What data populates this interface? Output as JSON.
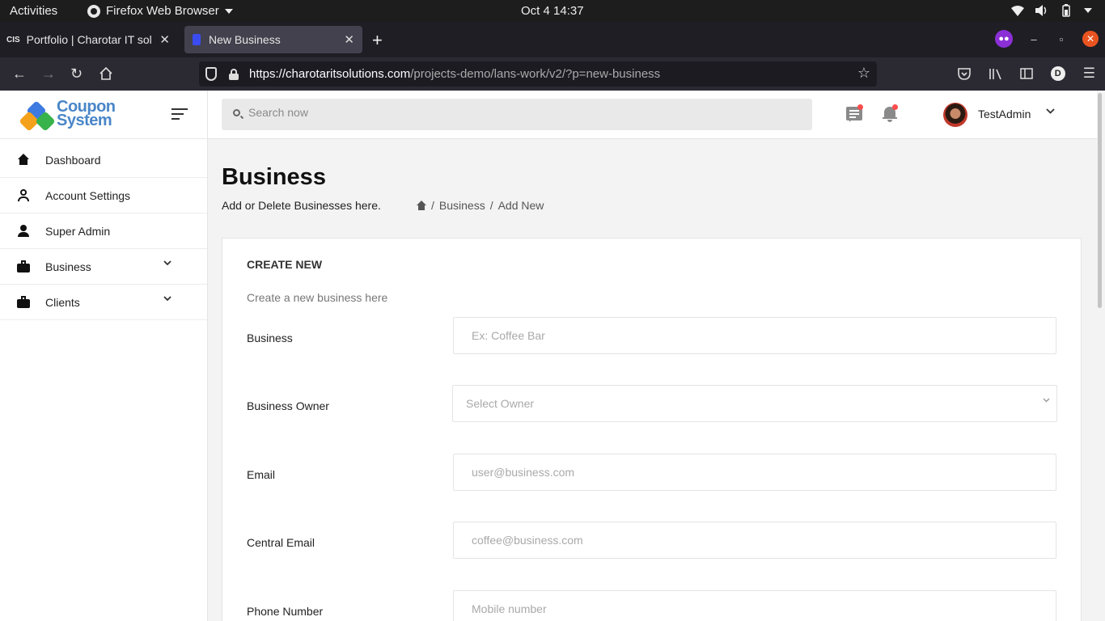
{
  "system_bar": {
    "activities": "Activities",
    "app_name": "Firefox Web Browser",
    "clock": "Oct 4  14:37"
  },
  "browser": {
    "tabs": [
      {
        "favicon": "CIS",
        "title": "Portfolio | Charotar IT sol"
      },
      {
        "favicon": "",
        "title": "New Business"
      }
    ],
    "url_host": "https://charotaritsolutions.com",
    "url_path": "/projects-demo/lans-work/v2/?p=new-business",
    "profile_initial": "D"
  },
  "app": {
    "logo_line1": "Coupon",
    "logo_line2": "System",
    "sidebar": {
      "items": [
        {
          "label": "Dashboard",
          "icon": "home-icon"
        },
        {
          "label": "Account Settings",
          "icon": "account-outline-icon"
        },
        {
          "label": "Super Admin",
          "icon": "account-icon"
        },
        {
          "label": "Business",
          "icon": "briefcase-icon",
          "expandable": true
        },
        {
          "label": "Clients",
          "icon": "briefcase-icon",
          "expandable": true
        }
      ]
    },
    "header": {
      "search_placeholder": "Search now",
      "username": "TestAdmin"
    },
    "page": {
      "title": "Business",
      "subtitle": "Add or Delete Businesses here.",
      "breadcrumb": [
        "Business",
        "Add New"
      ]
    },
    "card": {
      "title": "CREATE NEW",
      "subtitle": "Create a new business here",
      "fields": [
        {
          "label": "Business",
          "placeholder": "Ex: Coffee Bar"
        },
        {
          "label": "Business Owner",
          "placeholder": "Select Owner"
        },
        {
          "label": "Email",
          "placeholder": "user@business.com"
        },
        {
          "label": "Central Email",
          "placeholder": "coffee@business.com"
        },
        {
          "label": "Phone Number",
          "placeholder": "Mobile number"
        }
      ]
    }
  },
  "colors": {
    "accent_notification": "#ff4c4c",
    "logo_blue": "#4a86c8"
  }
}
